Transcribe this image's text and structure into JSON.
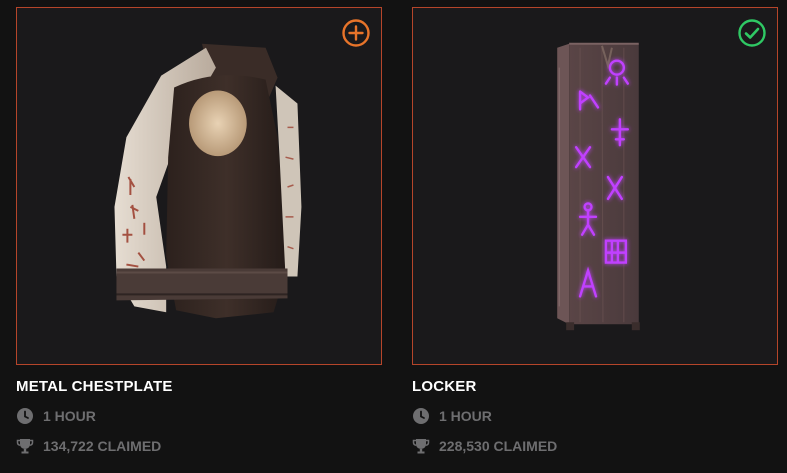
{
  "colors": {
    "background": "#121212",
    "card_border": "#b5452a",
    "add_badge": "#e8742a",
    "owned_badge": "#2fc864",
    "meta_text": "#6e6e70",
    "rune_glow": "#c040ff"
  },
  "cards": [
    {
      "title": "METAL CHESTPLATE",
      "duration": "1 HOUR",
      "claimed": "134,722 CLAIMED",
      "status_icon": "plus-circle-icon",
      "image_subject": "metal-chestplate-image"
    },
    {
      "title": "LOCKER",
      "duration": "1 HOUR",
      "claimed": "228,530 CLAIMED",
      "status_icon": "check-circle-icon",
      "image_subject": "locker-image"
    }
  ]
}
